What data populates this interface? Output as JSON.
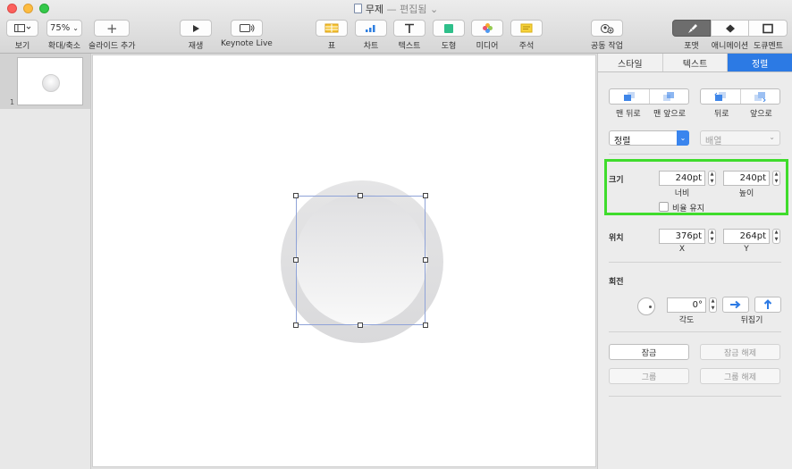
{
  "window": {
    "title": "무제",
    "separator": "—",
    "status": "편집됨"
  },
  "toolbar": {
    "view_label": "보기",
    "zoom_value": "75%",
    "zoom_label": "확대/축소",
    "add_slide_label": "슬라이드 추가",
    "play_label": "재생",
    "keynote_live_label": "Keynote Live",
    "table_label": "표",
    "chart_label": "차트",
    "text_label": "텍스트",
    "shape_label": "도형",
    "media_label": "미디어",
    "comment_label": "주석",
    "collaborate_label": "공동 작업",
    "format_label": "포맷",
    "animate_label": "애니메이션",
    "document_label": "도큐멘트"
  },
  "navigator": {
    "slides": [
      {
        "number": "1"
      }
    ]
  },
  "inspector": {
    "tabs": [
      {
        "label": "스타일"
      },
      {
        "label": "텍스트"
      },
      {
        "label": "정렬"
      }
    ],
    "arrange": {
      "back_label": "맨 뒤로",
      "front_label": "맨 앞으로",
      "backward_label": "뒤로",
      "forward_label": "앞으로"
    },
    "align_select": "정렬",
    "distribute_select": "배열",
    "size": {
      "heading": "크기",
      "width_value": "240pt",
      "width_label": "너비",
      "height_value": "240pt",
      "height_label": "높이",
      "constrain_label": "비율 유지"
    },
    "position": {
      "heading": "위치",
      "x_value": "376pt",
      "x_label": "X",
      "y_value": "264pt",
      "y_label": "Y"
    },
    "rotate": {
      "heading": "회전",
      "angle_value": "0°",
      "angle_label": "각도",
      "flip_label": "뒤집기"
    },
    "lock_label": "잠금",
    "unlock_label": "잠금 해제",
    "group_label": "그룹",
    "ungroup_label": "그룹 해제"
  },
  "colors": {
    "accent": "#2c7ae4",
    "highlight": "#3fdc2c"
  }
}
